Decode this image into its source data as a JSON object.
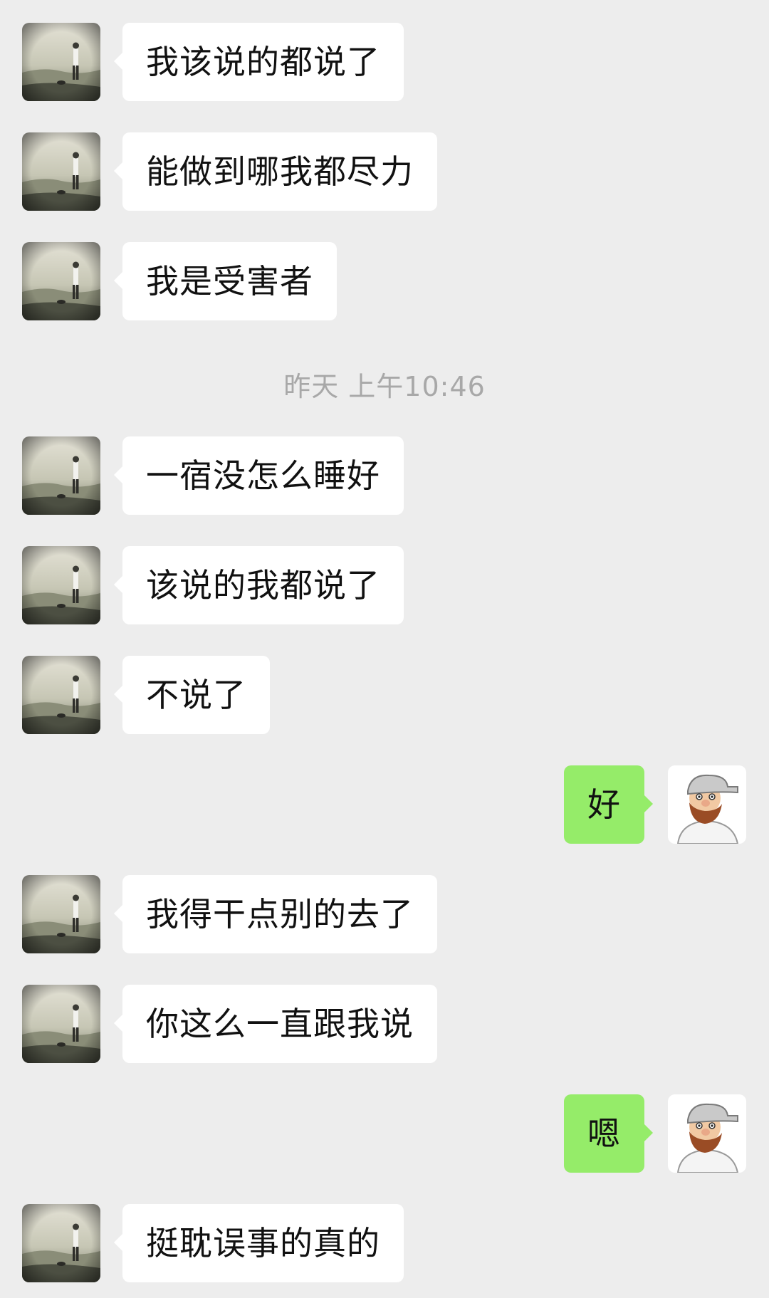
{
  "timestamp": "昨天 上午10:46",
  "messages_before": [
    {
      "text": "我该说的都说了"
    },
    {
      "text": "能做到哪我都尽力"
    },
    {
      "text": "我是受害者"
    }
  ],
  "messages_after": [
    {
      "text": "一宿没怎么睡好"
    },
    {
      "text": "该说的我都说了"
    },
    {
      "text": "不说了"
    },
    {
      "text": "好"
    },
    {
      "text": "我得干点别的去了"
    },
    {
      "text": "你这么一直跟我说"
    },
    {
      "text": "嗯"
    },
    {
      "text": "挺耽误事的真的"
    }
  ],
  "colors": {
    "background": "#ededed",
    "received_bubble": "#ffffff",
    "sent_bubble": "#95ec69",
    "timestamp_text": "#a8a8a8"
  }
}
